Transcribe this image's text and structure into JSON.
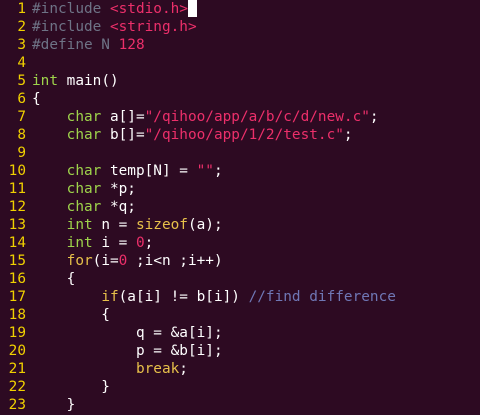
{
  "lines": [
    {
      "n": "1",
      "segs": [
        [
          "pp",
          "#include "
        ],
        [
          "str",
          "<stdio.h>"
        ]
      ],
      "cursor": true
    },
    {
      "n": "2",
      "segs": [
        [
          "pp",
          "#include "
        ],
        [
          "str",
          "<string.h>"
        ]
      ]
    },
    {
      "n": "3",
      "segs": [
        [
          "pp",
          "#define N "
        ],
        [
          "num",
          "128"
        ]
      ]
    },
    {
      "n": "4",
      "segs": []
    },
    {
      "n": "5",
      "segs": [
        [
          "kw",
          "int"
        ],
        [
          "code",
          " main()"
        ]
      ]
    },
    {
      "n": "6",
      "segs": [
        [
          "code",
          "{"
        ]
      ]
    },
    {
      "n": "7",
      "segs": [
        [
          "code",
          "    "
        ],
        [
          "kw",
          "char"
        ],
        [
          "code",
          " a[]="
        ],
        [
          "str",
          "\"/qihoo/app/a/b/c/d/new.c\""
        ],
        [
          "code",
          ";"
        ]
      ]
    },
    {
      "n": "8",
      "segs": [
        [
          "code",
          "    "
        ],
        [
          "kw",
          "char"
        ],
        [
          "code",
          " b[]="
        ],
        [
          "str",
          "\"/qihoo/app/1/2/test.c\""
        ],
        [
          "code",
          ";"
        ]
      ]
    },
    {
      "n": "9",
      "segs": []
    },
    {
      "n": "10",
      "segs": [
        [
          "code",
          "    "
        ],
        [
          "kw",
          "char"
        ],
        [
          "code",
          " temp[N] = "
        ],
        [
          "str",
          "\"\""
        ],
        [
          "code",
          ";"
        ]
      ]
    },
    {
      "n": "11",
      "segs": [
        [
          "code",
          "    "
        ],
        [
          "kw",
          "char"
        ],
        [
          "code",
          " *p;"
        ]
      ]
    },
    {
      "n": "12",
      "segs": [
        [
          "code",
          "    "
        ],
        [
          "kw",
          "char"
        ],
        [
          "code",
          " *q;"
        ]
      ]
    },
    {
      "n": "13",
      "segs": [
        [
          "code",
          "    "
        ],
        [
          "kw",
          "int"
        ],
        [
          "code",
          " n = "
        ],
        [
          "ctl",
          "sizeof"
        ],
        [
          "code",
          "(a);"
        ]
      ]
    },
    {
      "n": "14",
      "segs": [
        [
          "code",
          "    "
        ],
        [
          "kw",
          "int"
        ],
        [
          "code",
          " i = "
        ],
        [
          "num",
          "0"
        ],
        [
          "code",
          ";"
        ]
      ]
    },
    {
      "n": "15",
      "segs": [
        [
          "code",
          "    "
        ],
        [
          "ctl",
          "for"
        ],
        [
          "code",
          "(i="
        ],
        [
          "num",
          "0"
        ],
        [
          "code",
          " ;i<n ;i++)"
        ]
      ]
    },
    {
      "n": "16",
      "segs": [
        [
          "code",
          "    {"
        ]
      ]
    },
    {
      "n": "17",
      "segs": [
        [
          "code",
          "        "
        ],
        [
          "ctl",
          "if"
        ],
        [
          "code",
          "(a[i] != b[i]) "
        ],
        [
          "cmt",
          "//find difference"
        ]
      ]
    },
    {
      "n": "18",
      "segs": [
        [
          "code",
          "        {"
        ]
      ]
    },
    {
      "n": "19",
      "segs": [
        [
          "code",
          "            q = &a[i];"
        ]
      ]
    },
    {
      "n": "20",
      "segs": [
        [
          "code",
          "            p = &b[i];"
        ]
      ]
    },
    {
      "n": "21",
      "segs": [
        [
          "code",
          "            "
        ],
        [
          "ctl",
          "break"
        ],
        [
          "code",
          ";"
        ]
      ]
    },
    {
      "n": "22",
      "segs": [
        [
          "code",
          "        }"
        ]
      ]
    },
    {
      "n": "23",
      "segs": [
        [
          "code",
          "    }"
        ]
      ]
    }
  ]
}
